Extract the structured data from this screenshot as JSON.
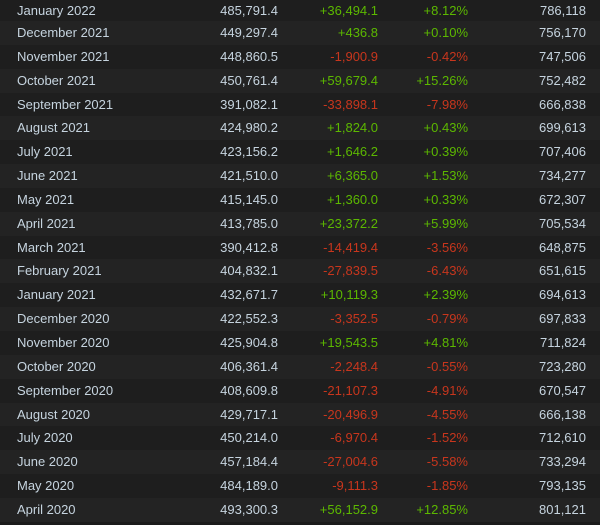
{
  "colors": {
    "background": "#1b1b1b",
    "row_odd": "#1e1e1e",
    "row_even": "#232323",
    "text": "#c6d4df",
    "positive": "#5cb800",
    "negative": "#c8361d"
  },
  "rows": [
    {
      "month": "January 2022",
      "avg": "485,791.4",
      "gain": "+36,494.1",
      "pct": "+8.12%",
      "peak": "786,118",
      "trend": "pos"
    },
    {
      "month": "December 2021",
      "avg": "449,297.4",
      "gain": "+436.8",
      "pct": "+0.10%",
      "peak": "756,170",
      "trend": "pos"
    },
    {
      "month": "November 2021",
      "avg": "448,860.5",
      "gain": "-1,900.9",
      "pct": "-0.42%",
      "peak": "747,506",
      "trend": "neg"
    },
    {
      "month": "October 2021",
      "avg": "450,761.4",
      "gain": "+59,679.4",
      "pct": "+15.26%",
      "peak": "752,482",
      "trend": "pos"
    },
    {
      "month": "September 2021",
      "avg": "391,082.1",
      "gain": "-33,898.1",
      "pct": "-7.98%",
      "peak": "666,838",
      "trend": "neg"
    },
    {
      "month": "August 2021",
      "avg": "424,980.2",
      "gain": "+1,824.0",
      "pct": "+0.43%",
      "peak": "699,613",
      "trend": "pos"
    },
    {
      "month": "July 2021",
      "avg": "423,156.2",
      "gain": "+1,646.2",
      "pct": "+0.39%",
      "peak": "707,406",
      "trend": "pos"
    },
    {
      "month": "June 2021",
      "avg": "421,510.0",
      "gain": "+6,365.0",
      "pct": "+1.53%",
      "peak": "734,277",
      "trend": "pos"
    },
    {
      "month": "May 2021",
      "avg": "415,145.0",
      "gain": "+1,360.0",
      "pct": "+0.33%",
      "peak": "672,307",
      "trend": "pos"
    },
    {
      "month": "April 2021",
      "avg": "413,785.0",
      "gain": "+23,372.2",
      "pct": "+5.99%",
      "peak": "705,534",
      "trend": "pos"
    },
    {
      "month": "March 2021",
      "avg": "390,412.8",
      "gain": "-14,419.4",
      "pct": "-3.56%",
      "peak": "648,875",
      "trend": "neg"
    },
    {
      "month": "February 2021",
      "avg": "404,832.1",
      "gain": "-27,839.5",
      "pct": "-6.43%",
      "peak": "651,615",
      "trend": "neg"
    },
    {
      "month": "January 2021",
      "avg": "432,671.7",
      "gain": "+10,119.3",
      "pct": "+2.39%",
      "peak": "694,613",
      "trend": "pos"
    },
    {
      "month": "December 2020",
      "avg": "422,552.3",
      "gain": "-3,352.5",
      "pct": "-0.79%",
      "peak": "697,833",
      "trend": "neg"
    },
    {
      "month": "November 2020",
      "avg": "425,904.8",
      "gain": "+19,543.5",
      "pct": "+4.81%",
      "peak": "711,824",
      "trend": "pos"
    },
    {
      "month": "October 2020",
      "avg": "406,361.4",
      "gain": "-2,248.4",
      "pct": "-0.55%",
      "peak": "723,280",
      "trend": "neg"
    },
    {
      "month": "September 2020",
      "avg": "408,609.8",
      "gain": "-21,107.3",
      "pct": "-4.91%",
      "peak": "670,547",
      "trend": "neg"
    },
    {
      "month": "August 2020",
      "avg": "429,717.1",
      "gain": "-20,496.9",
      "pct": "-4.55%",
      "peak": "666,138",
      "trend": "neg"
    },
    {
      "month": "July 2020",
      "avg": "450,214.0",
      "gain": "-6,970.4",
      "pct": "-1.52%",
      "peak": "712,610",
      "trend": "neg"
    },
    {
      "month": "June 2020",
      "avg": "457,184.4",
      "gain": "-27,004.6",
      "pct": "-5.58%",
      "peak": "733,294",
      "trend": "neg"
    },
    {
      "month": "May 2020",
      "avg": "484,189.0",
      "gain": "-9,111.3",
      "pct": "-1.85%",
      "peak": "793,135",
      "trend": "neg"
    },
    {
      "month": "April 2020",
      "avg": "493,300.3",
      "gain": "+56,152.9",
      "pct": "+12.85%",
      "peak": "801,121",
      "trend": "pos"
    }
  ]
}
